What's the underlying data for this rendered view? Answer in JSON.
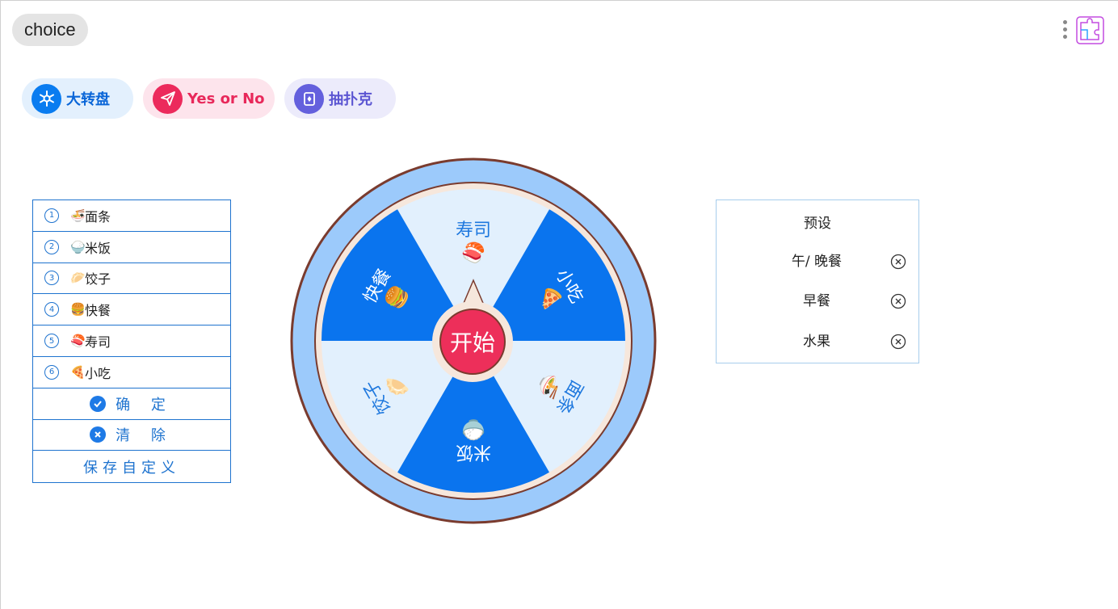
{
  "app": {
    "title": "choice"
  },
  "modes": [
    {
      "label": "大转盘",
      "color": "#0a7cf0"
    },
    {
      "label": "Yes or No",
      "color": "#ec2a5c"
    },
    {
      "label": "抽扑克",
      "color": "#6460dd"
    }
  ],
  "options": [
    {
      "num": "1",
      "emoji": "🍜",
      "label": "面条"
    },
    {
      "num": "2",
      "emoji": "🍚",
      "label": "米饭"
    },
    {
      "num": "3",
      "emoji": "🥟",
      "label": "饺子"
    },
    {
      "num": "4",
      "emoji": "🍔",
      "label": "快餐"
    },
    {
      "num": "5",
      "emoji": "🍣",
      "label": "寿司"
    },
    {
      "num": "6",
      "emoji": "🍕",
      "label": "小吃"
    }
  ],
  "actions": {
    "confirm": "确 定",
    "clear": "清 除",
    "save": "保存自定义"
  },
  "wheel": {
    "start": "开始",
    "colors": {
      "dark": "#0a74ee",
      "light": "#e2f0fd",
      "rim": "#9ccafb",
      "border": "#7a3b2e"
    },
    "segments": [
      {
        "emoji": "🍣",
        "label": "寿司"
      },
      {
        "emoji": "🍕",
        "label": "小吃"
      },
      {
        "emoji": "🍜",
        "label": "面条"
      },
      {
        "emoji": "🍚",
        "label": "米饭"
      },
      {
        "emoji": "🥟",
        "label": "饺子"
      },
      {
        "emoji": "🍔",
        "label": "快餐"
      }
    ]
  },
  "presets": {
    "title": "预设",
    "items": [
      {
        "label": "午/ 晚餐"
      },
      {
        "label": "早餐"
      },
      {
        "label": "水果"
      }
    ]
  }
}
